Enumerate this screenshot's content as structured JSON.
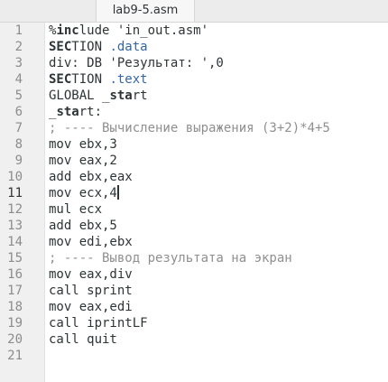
{
  "tab": {
    "title": "lab9-5.asm"
  },
  "current_line": 11,
  "lines": [
    {
      "num": "1",
      "segs": [
        {
          "t": "%",
          "c": "pl"
        },
        {
          "t": "inc",
          "c": "kw"
        },
        {
          "t": "lude 'in_out.asm'",
          "c": "pl"
        }
      ]
    },
    {
      "num": "2",
      "segs": [
        {
          "t": "SEC",
          "c": "kw"
        },
        {
          "t": "TION ",
          "c": "pl"
        },
        {
          "t": ".data",
          "c": "sec"
        }
      ]
    },
    {
      "num": "3",
      "segs": [
        {
          "t": "div: DB 'Результат: ',0",
          "c": "pl"
        }
      ]
    },
    {
      "num": "4",
      "segs": [
        {
          "t": "SEC",
          "c": "kw"
        },
        {
          "t": "TION ",
          "c": "pl"
        },
        {
          "t": ".text",
          "c": "sec"
        }
      ]
    },
    {
      "num": "5",
      "segs": [
        {
          "t": "GLOBAL _",
          "c": "pl"
        },
        {
          "t": "sta",
          "c": "kw"
        },
        {
          "t": "rt",
          "c": "pl"
        }
      ]
    },
    {
      "num": "6",
      "segs": [
        {
          "t": "_",
          "c": "pl"
        },
        {
          "t": "sta",
          "c": "kw"
        },
        {
          "t": "rt:",
          "c": "pl"
        }
      ]
    },
    {
      "num": "7",
      "segs": [
        {
          "t": "; ---- Вычисление выражения (3+2)*4+5",
          "c": "cm"
        }
      ]
    },
    {
      "num": "8",
      "segs": [
        {
          "t": "mov ebx,3",
          "c": "pl"
        }
      ]
    },
    {
      "num": "9",
      "segs": [
        {
          "t": "mov eax,2",
          "c": "pl"
        }
      ]
    },
    {
      "num": "10",
      "segs": [
        {
          "t": "add ebx,eax",
          "c": "pl"
        }
      ]
    },
    {
      "num": "11",
      "segs": [
        {
          "t": "mov ecx,4",
          "c": "pl"
        }
      ],
      "caret": true
    },
    {
      "num": "12",
      "segs": [
        {
          "t": "mul ecx",
          "c": "pl"
        }
      ]
    },
    {
      "num": "13",
      "segs": [
        {
          "t": "add ebx,5",
          "c": "pl"
        }
      ]
    },
    {
      "num": "14",
      "segs": [
        {
          "t": "mov edi,ebx",
          "c": "pl"
        }
      ]
    },
    {
      "num": "15",
      "segs": [
        {
          "t": "; ---- Вывод результата на экран",
          "c": "cm"
        }
      ]
    },
    {
      "num": "16",
      "segs": [
        {
          "t": "mov eax,div",
          "c": "pl"
        }
      ]
    },
    {
      "num": "17",
      "segs": [
        {
          "t": "call sprint",
          "c": "pl"
        }
      ]
    },
    {
      "num": "18",
      "segs": [
        {
          "t": "mov eax,edi",
          "c": "pl"
        }
      ]
    },
    {
      "num": "19",
      "segs": [
        {
          "t": "call iprintLF",
          "c": "pl"
        }
      ]
    },
    {
      "num": "20",
      "segs": [
        {
          "t": "call quit",
          "c": "pl"
        }
      ]
    },
    {
      "num": "21",
      "segs": []
    }
  ]
}
